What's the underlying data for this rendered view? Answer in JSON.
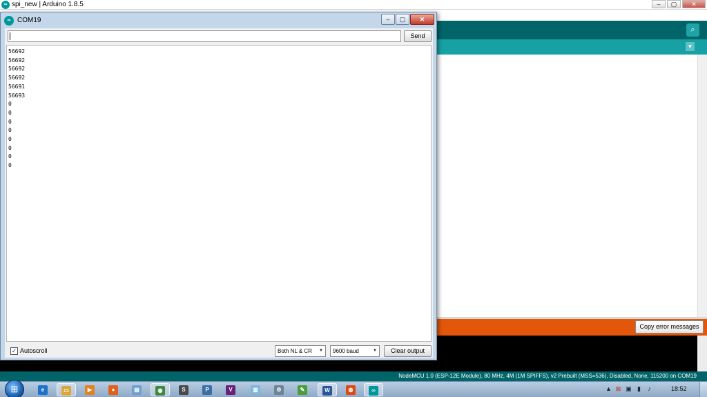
{
  "ide": {
    "title": "spi_new | Arduino 1.8.5",
    "copy_errors_label": "Copy error messages",
    "board_info": "NodeMCU 1.0 (ESP-12E Module), 80 MHz, 4M (1M SPIFFS), v2 Prebuilt (MSS=536), Disabled, None, 115200 on COM19",
    "colors": {
      "toolbar": "#006468",
      "tabbar": "#17a1a5",
      "errorbar": "#e2570a",
      "console": "#000000"
    }
  },
  "serial": {
    "title": "COM19",
    "send_input_value": "",
    "send_label": "Send",
    "output": [
      "56692",
      "56692",
      "56692",
      "56692",
      "56691",
      "56693",
      "0",
      "0",
      "0",
      "0",
      "0",
      "0",
      "0",
      "0"
    ],
    "autoscroll_label": "Autoscroll",
    "autoscroll_checked": true,
    "line_ending": "Both NL & CR",
    "baud": "9600 baud",
    "clear_label": "Clear output"
  },
  "taskbar": {
    "apps": [
      {
        "name": "internet-explorer",
        "glyph": "e",
        "color": "#1e73c9"
      },
      {
        "name": "file-explorer",
        "glyph": "▭",
        "color": "#d9a63b",
        "open": true
      },
      {
        "name": "media-player",
        "glyph": "▶",
        "color": "#e5801e"
      },
      {
        "name": "firefox",
        "glyph": "●",
        "color": "#e0601c"
      },
      {
        "name": "notepad",
        "glyph": "▤",
        "color": "#6f9fd0"
      },
      {
        "name": "chrome",
        "glyph": "◉",
        "color": "#3b8a3e",
        "open": true
      },
      {
        "name": "sublime-text",
        "glyph": "S",
        "color": "#4a4a4a"
      },
      {
        "name": "python",
        "glyph": "P",
        "color": "#3a6fa5"
      },
      {
        "name": "visual-studio",
        "glyph": "V",
        "color": "#68217a"
      },
      {
        "name": "documents",
        "glyph": "▥",
        "color": "#7fb6d9"
      },
      {
        "name": "settings",
        "glyph": "⚙",
        "color": "#6e8596"
      },
      {
        "name": "paint",
        "glyph": "✎",
        "color": "#4b9d3c"
      },
      {
        "name": "word",
        "glyph": "W",
        "color": "#2b579a",
        "open": true
      },
      {
        "name": "ubuntu",
        "glyph": "◍",
        "color": "#dd4814"
      },
      {
        "name": "arduino",
        "glyph": "∞",
        "color": "#00979c",
        "open": true
      }
    ],
    "tray_icons": [
      "arrow-up",
      "network-error",
      "device",
      "signal",
      "volume"
    ],
    "clock": "18:52"
  }
}
